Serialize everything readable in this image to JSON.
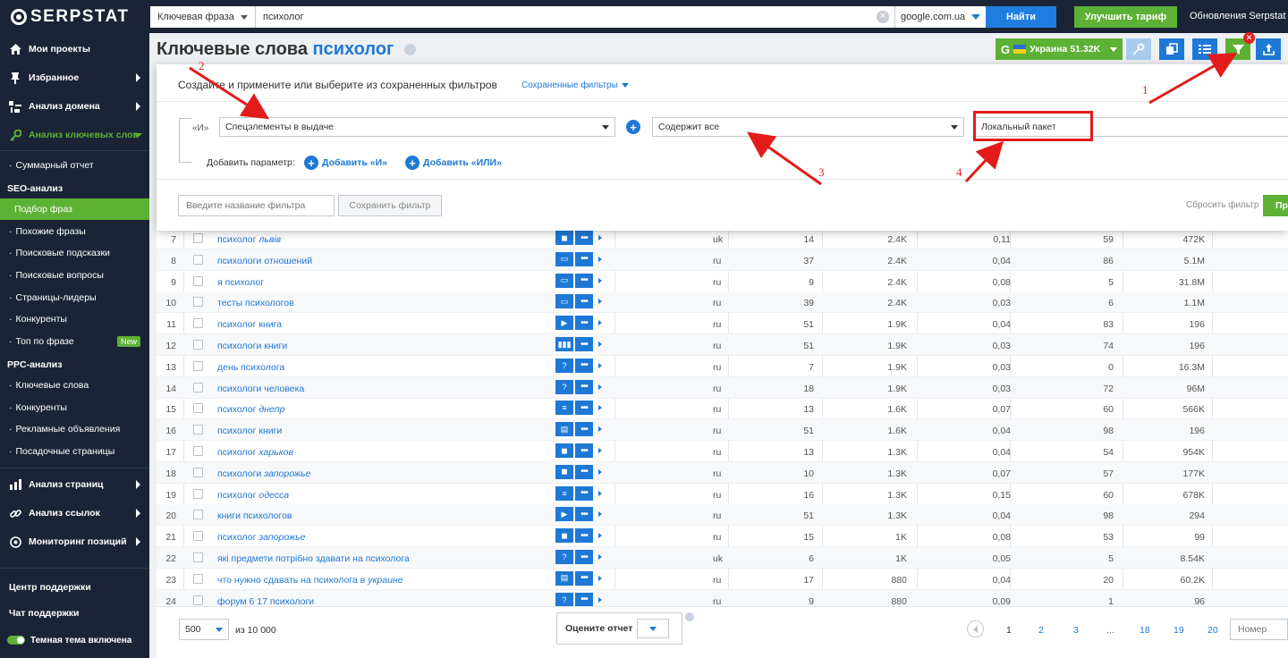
{
  "topbar": {
    "logo": "SERPSTAT",
    "search_type": "Ключевая фраза",
    "search_value": "психолог",
    "database": "google.com.ua",
    "find_label": "Найти",
    "upgrade_label": "Улучшить тариф",
    "updates_label": "Обновления Serpstat"
  },
  "sidebar": {
    "main_top": [
      {
        "label": "Мои проекты",
        "icon": "home-icon"
      },
      {
        "label": "Избранное",
        "icon": "pin-icon"
      },
      {
        "label": "Анализ домена",
        "icon": "domain-icon"
      },
      {
        "label": "Анализ ключевых слов",
        "icon": "key-icon"
      }
    ],
    "summary": "Суммарный отчет",
    "seo_head": "SEO-анализ",
    "seo_items": [
      "Подбор фраз",
      "Похожие фразы",
      "Поисковые подсказки",
      "Поисковые вопросы",
      "Страницы-лидеры",
      "Конкуренты",
      "Топ по фразе"
    ],
    "new_badge": "New",
    "ppc_head": "PPC-анализ",
    "ppc_items": [
      "Ключевые слова",
      "Конкуренты",
      "Рекламные объявления",
      "Посадочные страницы"
    ],
    "main_bottom": [
      {
        "label": "Анализ страниц",
        "icon": "bar-chart-icon"
      },
      {
        "label": "Анализ ссылок",
        "icon": "link-icon"
      },
      {
        "label": "Мониторинг позиций",
        "icon": "target-icon"
      }
    ],
    "support_center": "Центр поддержки",
    "support_chat": "Чат поддержки",
    "dark_theme": "Темная тема включена"
  },
  "header": {
    "title_prefix": "Ключевые слова",
    "title_keyword": "психолог",
    "region_g": "G",
    "region_label": "Украина 51.32K"
  },
  "filter": {
    "title": "Создайте и примените или выберите из сохраненных фильтров",
    "saved_label": "Сохраненные фильтры",
    "and_label": "«И»",
    "param_select": "Спецэлементы в выдаче",
    "condition_select": "Содержит все",
    "value_select": "Локальный пакет",
    "add_param_label": "Добавить параметр:",
    "add_and": "Добавить «И»",
    "add_or": "Добавить «ИЛИ»",
    "name_placeholder": "Введите название фильтра",
    "save_label": "Сохранить фильтр",
    "reset_label": "Сбросить фильтр",
    "apply_label": "Пр"
  },
  "table": {
    "rows": [
      {
        "n": "7",
        "kw": "психолог ",
        "kw_i": "львів",
        "f": "◼",
        "lang": "uk",
        "len": "14",
        "vol": "2.4K",
        "cpc": "0,11",
        "comp": "59",
        "res": "472K"
      },
      {
        "n": "8",
        "kw": "психологи отношений",
        "kw_i": "",
        "f": "▭",
        "lang": "ru",
        "len": "37",
        "vol": "2.4K",
        "cpc": "0,04",
        "comp": "86",
        "res": "5.1M"
      },
      {
        "n": "9",
        "kw": "я психолог",
        "kw_i": "",
        "f": "▭",
        "lang": "ru",
        "len": "9",
        "vol": "2.4K",
        "cpc": "0,08",
        "comp": "5",
        "res": "31.8M"
      },
      {
        "n": "10",
        "kw": "тесты психологов",
        "kw_i": "",
        "f": "▭",
        "lang": "ru",
        "len": "39",
        "vol": "2.4K",
        "cpc": "0,03",
        "comp": "6",
        "res": "1.1M"
      },
      {
        "n": "11",
        "kw": "психолог книга",
        "kw_i": "",
        "f": "▶",
        "lang": "ru",
        "len": "51",
        "vol": "1.9K",
        "cpc": "0,04",
        "comp": "83",
        "res": "196"
      },
      {
        "n": "12",
        "kw": "психологи книги",
        "kw_i": "",
        "f": "▮▮▮",
        "lang": "ru",
        "len": "51",
        "vol": "1.9K",
        "cpc": "0,03",
        "comp": "74",
        "res": "196"
      },
      {
        "n": "13",
        "kw": "день психолога",
        "kw_i": "",
        "f": "?",
        "lang": "ru",
        "len": "7",
        "vol": "1.9K",
        "cpc": "0,03",
        "comp": "0",
        "res": "16.3M"
      },
      {
        "n": "14",
        "kw": "психологи человека",
        "kw_i": "",
        "f": "?",
        "lang": "ru",
        "len": "18",
        "vol": "1.9K",
        "cpc": "0,03",
        "comp": "72",
        "res": "96M"
      },
      {
        "n": "15",
        "kw": "психолог ",
        "kw_i": "днепр",
        "f": "≡",
        "lang": "ru",
        "len": "13",
        "vol": "1.6K",
        "cpc": "0,07",
        "comp": "60",
        "res": "566K"
      },
      {
        "n": "16",
        "kw": "психолог книги",
        "kw_i": "",
        "f": "▤",
        "lang": "ru",
        "len": "51",
        "vol": "1.6K",
        "cpc": "0,04",
        "comp": "98",
        "res": "196"
      },
      {
        "n": "17",
        "kw": "психолог ",
        "kw_i": "харьков",
        "f": "◼",
        "lang": "ru",
        "len": "13",
        "vol": "1.3K",
        "cpc": "0,04",
        "comp": "54",
        "res": "954K"
      },
      {
        "n": "18",
        "kw": "психологи ",
        "kw_i": "запорожье",
        "f": "◼",
        "lang": "ru",
        "len": "10",
        "vol": "1.3K",
        "cpc": "0,07",
        "comp": "57",
        "res": "177K"
      },
      {
        "n": "19",
        "kw": "психолог ",
        "kw_i": "одесса",
        "f": "≡",
        "lang": "ru",
        "len": "16",
        "vol": "1.3K",
        "cpc": "0,15",
        "comp": "60",
        "res": "678K"
      },
      {
        "n": "20",
        "kw": "книги психологов",
        "kw_i": "",
        "f": "▶",
        "lang": "ru",
        "len": "51",
        "vol": "1.3K",
        "cpc": "0,04",
        "comp": "98",
        "res": "294"
      },
      {
        "n": "21",
        "kw": "психолог ",
        "kw_i": "запорожье",
        "f": "◼",
        "lang": "ru",
        "len": "15",
        "vol": "1K",
        "cpc": "0,08",
        "comp": "53",
        "res": "99"
      },
      {
        "n": "22",
        "kw": "які предмети потрібно здавати на психолога",
        "kw_i": "",
        "f": "?",
        "lang": "uk",
        "len": "6",
        "vol": "1K",
        "cpc": "0,05",
        "comp": "5",
        "res": "8.54K"
      },
      {
        "n": "23",
        "kw": "что нужно сдавать на психолога в ",
        "kw_i": "украине",
        "f": "▤",
        "lang": "ru",
        "len": "17",
        "vol": "880",
        "cpc": "0,04",
        "comp": "20",
        "res": "60.2K"
      },
      {
        "n": "24",
        "kw": "форум 6 17 психологи",
        "kw_i": "",
        "f": "?",
        "lang": "ru",
        "len": "9",
        "vol": "880",
        "cpc": "0,09",
        "comp": "1",
        "res": "96"
      }
    ]
  },
  "footer": {
    "per_page": "500",
    "of_total": "из 10 000",
    "rate_label": "Оцените отчет",
    "pages": [
      "1",
      "2",
      "3",
      "...",
      "18",
      "19",
      "20"
    ],
    "page_placeholder": "Номер"
  },
  "annotations": {
    "labels": [
      "1",
      "2",
      "3",
      "4"
    ],
    "color": "#e31b1b"
  },
  "colors": {
    "sidebar_bg": "#1b2436",
    "accent_green": "#5db135",
    "accent_blue": "#1e78d6"
  }
}
